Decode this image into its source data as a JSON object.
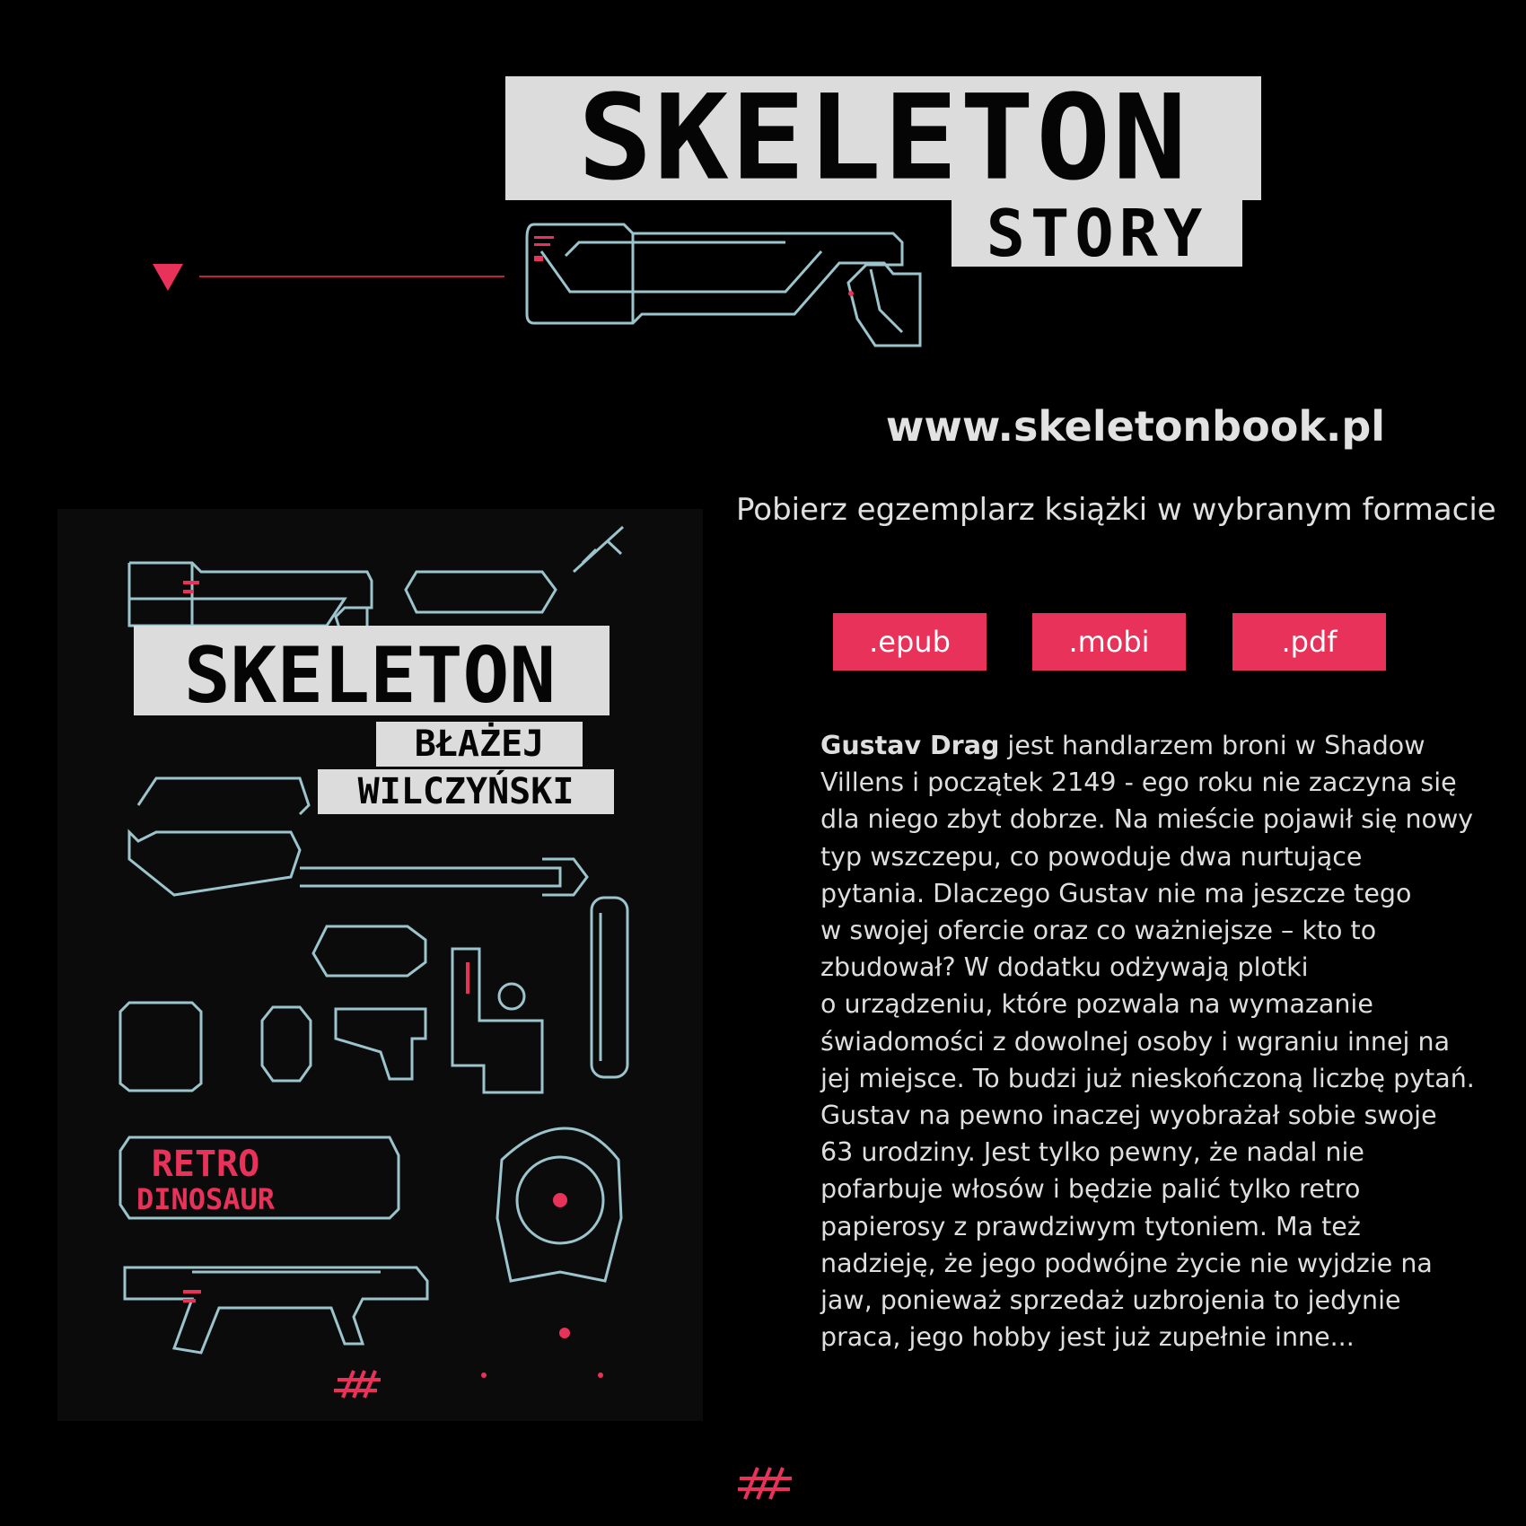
{
  "header": {
    "logo_title": "SKELETON",
    "logo_subtitle": "STORY",
    "url": "www.skeletonbook.pl",
    "tagline": "Pobierz egzemplarz książki w wybranym formacie"
  },
  "downloads": [
    {
      "label": ".epub"
    },
    {
      "label": ".mobi"
    },
    {
      "label": ".pdf"
    }
  ],
  "description": {
    "bold_name": "Gustav Drag",
    "first_line_rest": " jest handlarzem broni w Shadow",
    "lines": [
      "Villens i początek 2149 - ego roku nie zaczyna się",
      "dla niego zbyt dobrze. Na mieście pojawił się nowy",
      "typ wszczepu, co powoduje dwa nurtujące",
      "pytania. Dlaczego Gustav nie ma jeszcze tego",
      "w swojej ofercie oraz co ważniejsze – kto to",
      "zbudował? W dodatku odżywają plotki",
      "o urządzeniu, które pozwala na wymazanie",
      "świadomości z dowolnej osoby i wgraniu innej na",
      "jej miejsce. To budzi już nieskończoną liczbę pytań.",
      "Gustav na pewno inaczej wyobrażał sobie swoje",
      "63 urodziny. Jest tylko pewny, że nadal nie",
      "pofarbuje włosów i będzie palić tylko retro",
      "papierosy z prawdziwym tytoniem. Ma też",
      "nadzieję, że jego podwójne życie nie wyjdzie na",
      "jaw, ponieważ sprzedaż uzbrojenia to jedynie",
      "praca, jego hobby jest już zupełnie inne..."
    ]
  },
  "cover": {
    "title": "SKELETON",
    "author_first": "BŁAŻEJ",
    "author_last": "WILCZYŃSKI",
    "badge_line1": "RETRO",
    "badge_line2": "DINOSAUR"
  },
  "colors": {
    "accent": "#e8325a",
    "outline": "#9cc4cc",
    "logo_bg": "#dcdcdc",
    "background": "#000000"
  },
  "icons": [
    "down-triangle-icon",
    "hash-mark-icon",
    "rifle-icon",
    "skull-icon"
  ]
}
